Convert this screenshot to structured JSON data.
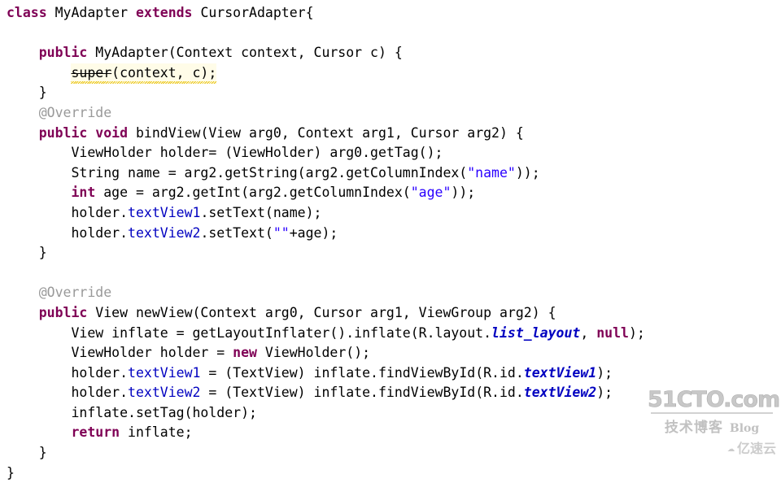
{
  "editor": {
    "language": "Java",
    "theme_colors": {
      "background": "#ffffff",
      "foreground": "#000000",
      "keyword": "#7f0055",
      "string": "#2a00ff",
      "annotation": "#999999",
      "field": "#0000c0",
      "static_field": "#0000c0",
      "warning_highlight": "#fffce8",
      "warning_squiggle": "#e8c000"
    },
    "lines": [
      {
        "n": 1,
        "indent": 0,
        "tokens": [
          {
            "t": "class ",
            "c": "kw"
          },
          {
            "t": "MyAdapter ",
            "c": "plain"
          },
          {
            "t": "extends ",
            "c": "kw"
          },
          {
            "t": "CursorAdapter{",
            "c": "plain"
          }
        ]
      },
      {
        "n": 2,
        "indent": 0,
        "tokens": []
      },
      {
        "n": 3,
        "indent": 4,
        "tokens": [
          {
            "t": "public ",
            "c": "kw"
          },
          {
            "t": "MyAdapter(Context context, Cursor c) {",
            "c": "plain"
          }
        ]
      },
      {
        "n": 4,
        "indent": 8,
        "warning": true,
        "tokens": [
          {
            "t": "super",
            "c": "plain",
            "deprecated": true
          },
          {
            "t": "(context, c);",
            "c": "plain"
          }
        ]
      },
      {
        "n": 5,
        "indent": 4,
        "tokens": [
          {
            "t": "}",
            "c": "plain"
          }
        ]
      },
      {
        "n": 6,
        "indent": 4,
        "tokens": [
          {
            "t": "@Override",
            "c": "ann"
          }
        ]
      },
      {
        "n": 7,
        "indent": 4,
        "tokens": [
          {
            "t": "public ",
            "c": "kw"
          },
          {
            "t": "void ",
            "c": "kw"
          },
          {
            "t": "bindView(View arg0, Context arg1, Cursor arg2) {",
            "c": "plain"
          }
        ]
      },
      {
        "n": 8,
        "indent": 8,
        "tokens": [
          {
            "t": "ViewHolder holder= (ViewHolder) arg0.getTag();",
            "c": "plain"
          }
        ]
      },
      {
        "n": 9,
        "indent": 8,
        "tokens": [
          {
            "t": "String name = arg2.getString(arg2.getColumnIndex(",
            "c": "plain"
          },
          {
            "t": "\"name\"",
            "c": "str"
          },
          {
            "t": "));",
            "c": "plain"
          }
        ]
      },
      {
        "n": 10,
        "indent": 8,
        "tokens": [
          {
            "t": "int ",
            "c": "kw"
          },
          {
            "t": "age = arg2.getInt(arg2.getColumnIndex(",
            "c": "plain"
          },
          {
            "t": "\"age\"",
            "c": "str"
          },
          {
            "t": "));",
            "c": "plain"
          }
        ]
      },
      {
        "n": 11,
        "indent": 8,
        "tokens": [
          {
            "t": "holder.",
            "c": "plain"
          },
          {
            "t": "textView1",
            "c": "field"
          },
          {
            "t": ".setText(name);",
            "c": "plain"
          }
        ]
      },
      {
        "n": 12,
        "indent": 8,
        "tokens": [
          {
            "t": "holder.",
            "c": "plain"
          },
          {
            "t": "textView2",
            "c": "field"
          },
          {
            "t": ".setText(",
            "c": "plain"
          },
          {
            "t": "\"\"",
            "c": "str"
          },
          {
            "t": "+age);",
            "c": "plain"
          }
        ]
      },
      {
        "n": 13,
        "indent": 4,
        "tokens": [
          {
            "t": "}",
            "c": "plain"
          }
        ]
      },
      {
        "n": 14,
        "indent": 0,
        "tokens": []
      },
      {
        "n": 15,
        "indent": 4,
        "tokens": [
          {
            "t": "@Override",
            "c": "ann"
          }
        ]
      },
      {
        "n": 16,
        "indent": 4,
        "tokens": [
          {
            "t": "public ",
            "c": "kw"
          },
          {
            "t": "View newView(Context arg0, Cursor arg1, ViewGroup arg2) {",
            "c": "plain"
          }
        ]
      },
      {
        "n": 17,
        "indent": 8,
        "tokens": [
          {
            "t": "View inflate = getLayoutInflater().inflate(R.layout.",
            "c": "plain"
          },
          {
            "t": "list_layout",
            "c": "sfield"
          },
          {
            "t": ", ",
            "c": "plain"
          },
          {
            "t": "null",
            "c": "kw"
          },
          {
            "t": ");",
            "c": "plain"
          }
        ]
      },
      {
        "n": 18,
        "indent": 8,
        "tokens": [
          {
            "t": "ViewHolder holder = ",
            "c": "plain"
          },
          {
            "t": "new ",
            "c": "kw"
          },
          {
            "t": "ViewHolder();",
            "c": "plain"
          }
        ]
      },
      {
        "n": 19,
        "indent": 8,
        "tokens": [
          {
            "t": "holder.",
            "c": "plain"
          },
          {
            "t": "textView1",
            "c": "field"
          },
          {
            "t": " = (TextView) inflate.findViewById(R.id.",
            "c": "plain"
          },
          {
            "t": "textView1",
            "c": "sfield"
          },
          {
            "t": ");",
            "c": "plain"
          }
        ]
      },
      {
        "n": 20,
        "indent": 8,
        "tokens": [
          {
            "t": "holder.",
            "c": "plain"
          },
          {
            "t": "textView2",
            "c": "field"
          },
          {
            "t": " = (TextView) inflate.findViewById(R.id.",
            "c": "plain"
          },
          {
            "t": "textView2",
            "c": "sfield"
          },
          {
            "t": ");",
            "c": "plain"
          }
        ]
      },
      {
        "n": 21,
        "indent": 8,
        "tokens": [
          {
            "t": "inflate.setTag(holder);",
            "c": "plain"
          }
        ]
      },
      {
        "n": 22,
        "indent": 8,
        "tokens": [
          {
            "t": "return ",
            "c": "kw"
          },
          {
            "t": "inflate;",
            "c": "plain"
          }
        ]
      },
      {
        "n": 23,
        "indent": 4,
        "tokens": [
          {
            "t": "}",
            "c": "plain"
          }
        ]
      },
      {
        "n": 24,
        "indent": 0,
        "tokens": [
          {
            "t": "}",
            "c": "plain"
          }
        ]
      }
    ]
  },
  "watermark": {
    "site": "51CTO.com",
    "tagline": "技术博客",
    "blog_label": "Blog",
    "secondary": "亿速云",
    "cloud_icon": "cloud-icon"
  }
}
